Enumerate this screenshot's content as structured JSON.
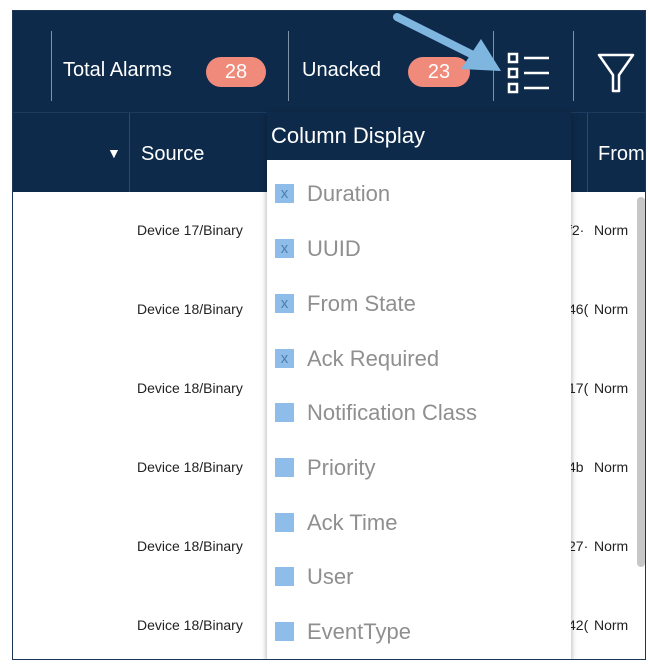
{
  "toolbar": {
    "total_label": "Total Alarms",
    "total_count": "28",
    "unacked_label": "Unacked",
    "unacked_count": "23",
    "column_icon": "column-list-icon",
    "filter_icon": "filter-icon"
  },
  "header": {
    "sort_glyph": "▼",
    "source": "Source",
    "from": "From"
  },
  "rows": [
    {
      "source": "Device 17/Binary",
      "id_frag": "f2·",
      "from_state": "Norm"
    },
    {
      "source": "Device 18/Binary",
      "id_frag": "46(",
      "from_state": "Norm"
    },
    {
      "source": "Device 18/Binary",
      "id_frag": "17(",
      "from_state": "Norm"
    },
    {
      "source": "Device 18/Binary",
      "id_frag": "4b",
      "from_state": "Norm"
    },
    {
      "source": "Device 18/Binary",
      "id_frag": "27·",
      "from_state": "Norm"
    },
    {
      "source": "Device 18/Binary",
      "id_frag": "42(",
      "from_state": "Norm"
    }
  ],
  "column_display": {
    "title": "Column Display",
    "items": [
      {
        "label": "Duration",
        "checked": true,
        "mark": "x"
      },
      {
        "label": "UUID",
        "checked": true,
        "mark": "x"
      },
      {
        "label": "From State",
        "checked": true,
        "mark": "x"
      },
      {
        "label": "Ack Required",
        "checked": true,
        "mark": "x"
      },
      {
        "label": "Notification Class",
        "checked": false,
        "mark": ""
      },
      {
        "label": "Priority",
        "checked": false,
        "mark": ""
      },
      {
        "label": "Ack Time",
        "checked": false,
        "mark": ""
      },
      {
        "label": "User",
        "checked": false,
        "mark": ""
      },
      {
        "label": "EventType",
        "checked": false,
        "mark": ""
      }
    ]
  },
  "colors": {
    "header_bg": "#0e2a4a",
    "badge": "#f08a7a",
    "checkbox": "#8dbde8",
    "callout_arrow": "#7fb6df"
  }
}
